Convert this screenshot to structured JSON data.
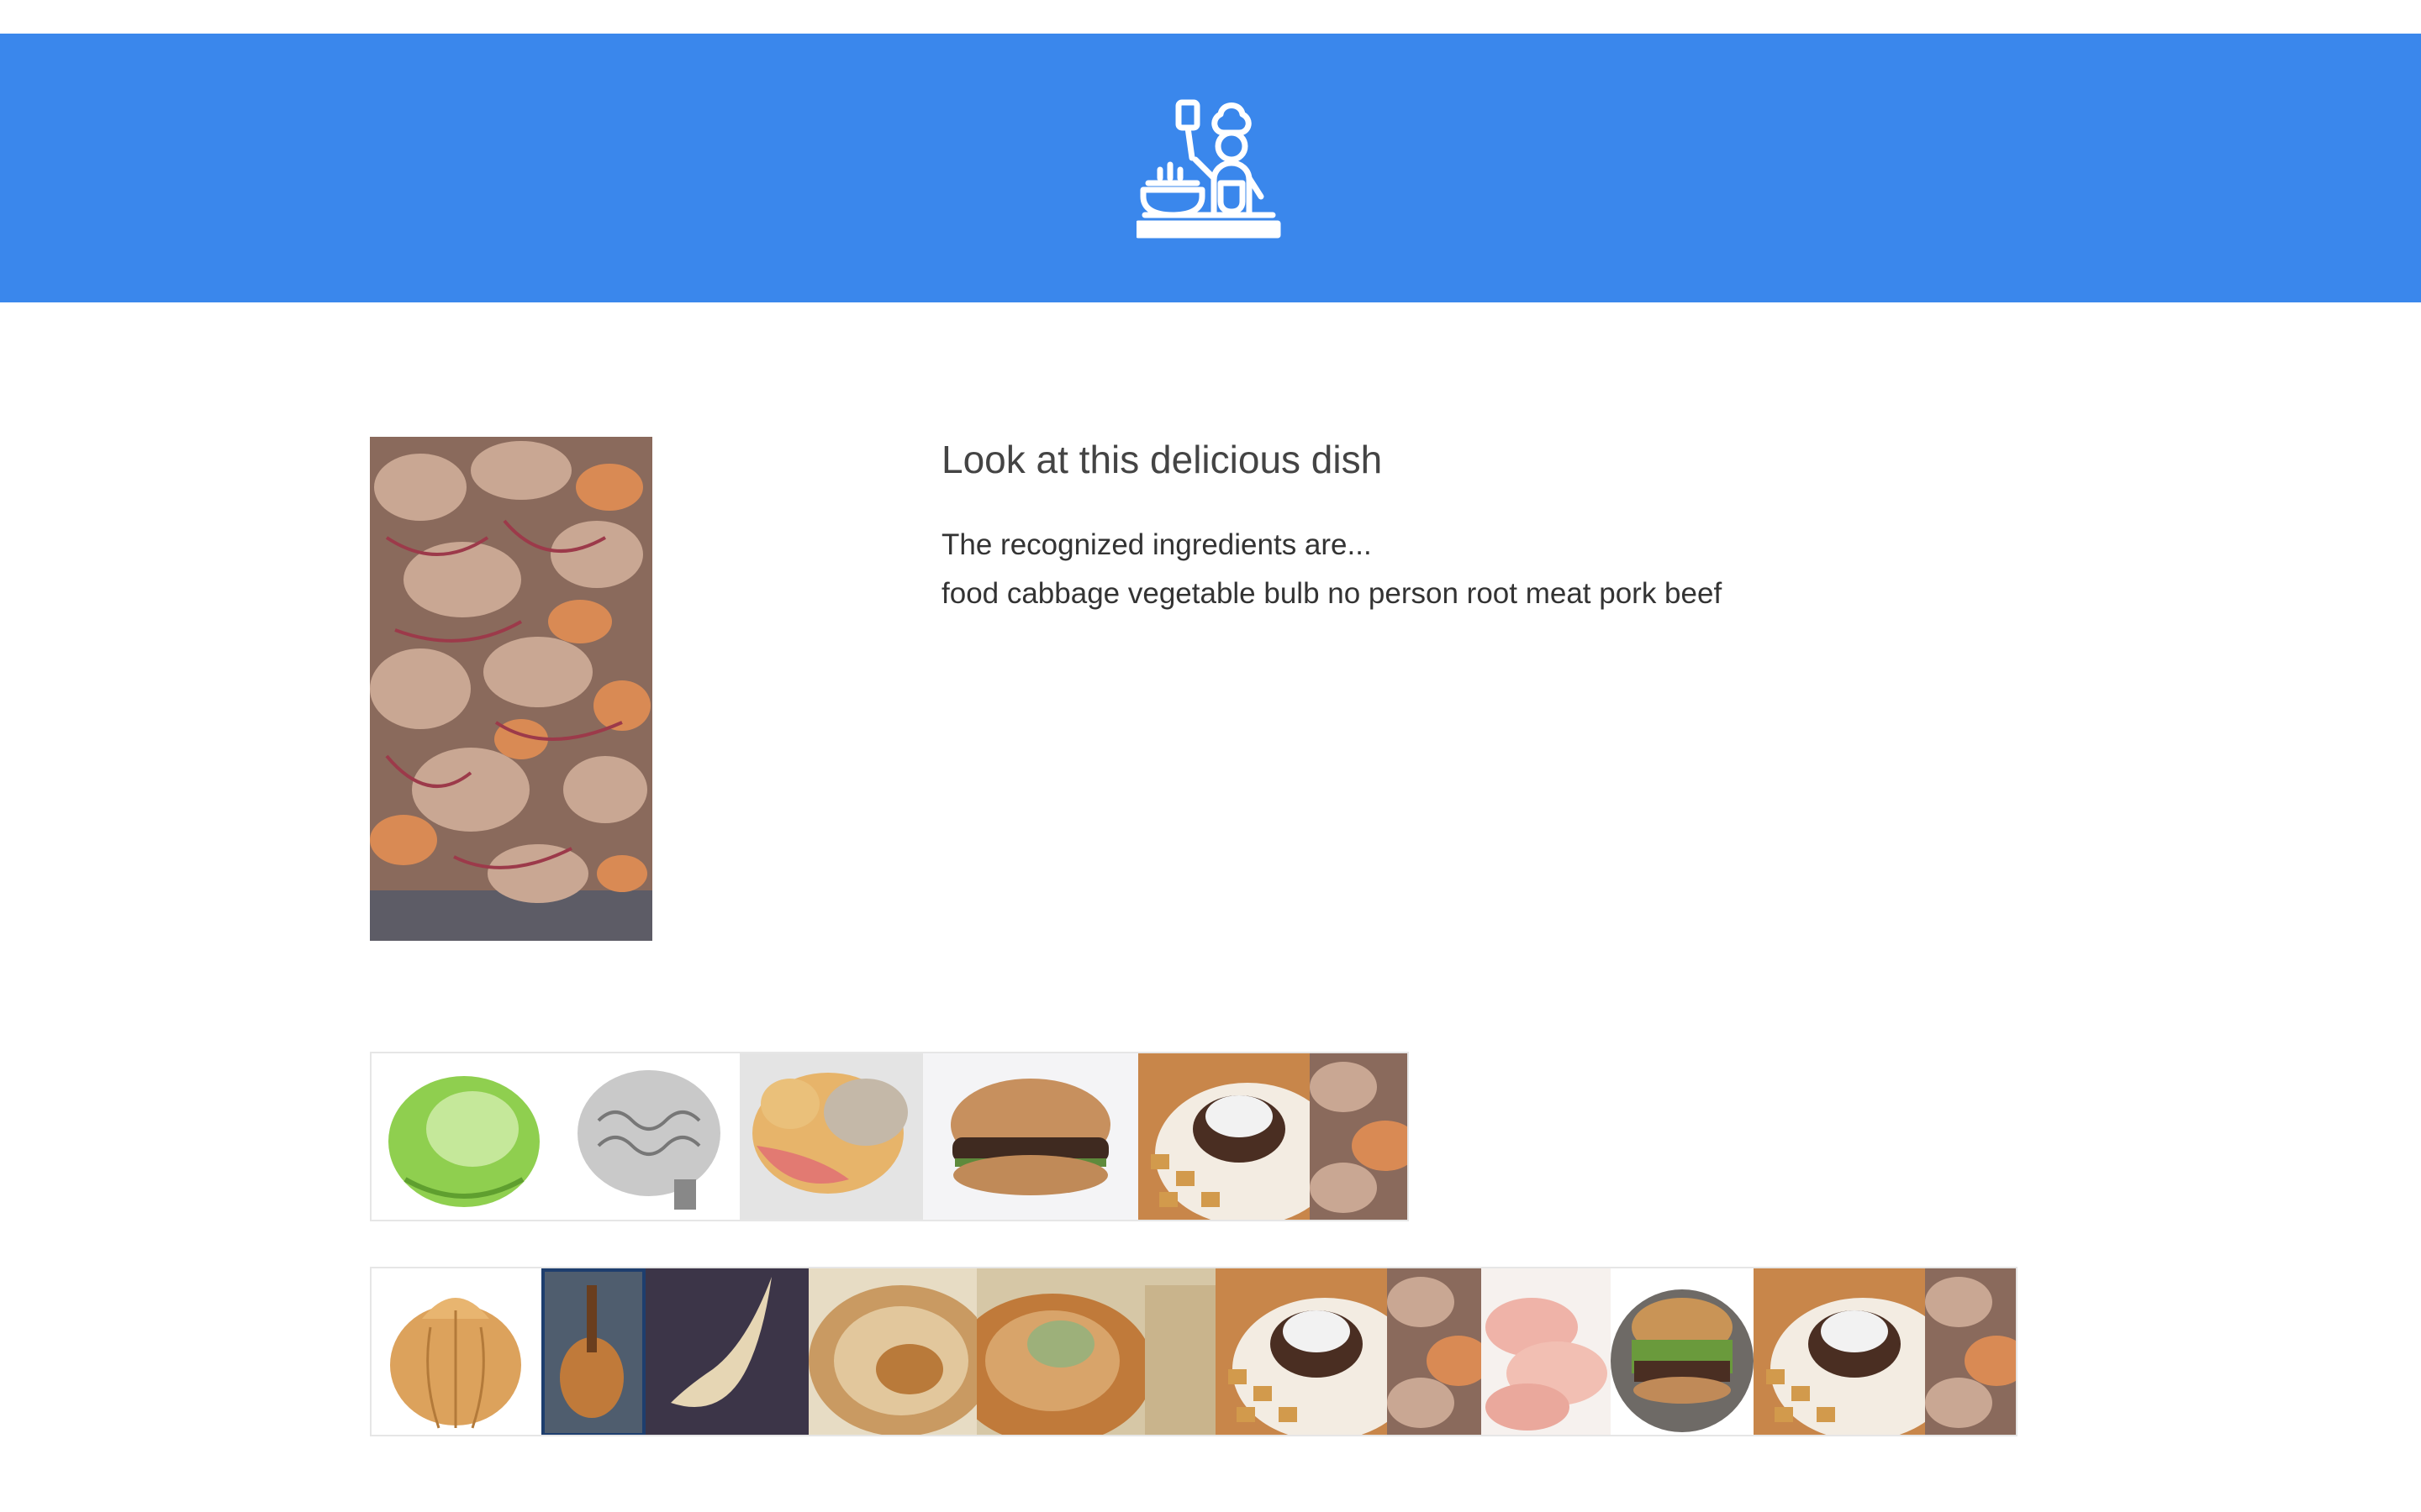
{
  "header": {
    "logo_icon": "chef-cooking-icon",
    "bg_color": "#3a87ec"
  },
  "dish": {
    "title": "Look at this delicious dish",
    "intro": "The recognized ingredients are...",
    "ingredients": "food cabbage vegetable bulb no person root meat pork beef",
    "photo_icon": "dish-photo-pork-peaches"
  },
  "gallery": {
    "row1": [
      "lettuce-image",
      "brain-model-gray-image",
      "brain-model-color-image",
      "burger-image",
      "burger-plate-image",
      "meat-dish-image"
    ],
    "row2": [
      "onion-image",
      "mandolin-image",
      "horn-image",
      "plate-food-image",
      "plate-pickles-image",
      "burger-plate-image",
      "meat-dish-image",
      "raw-pork-image",
      "burger-fries-image",
      "burger-plate-image",
      "meat-dish-image"
    ]
  }
}
